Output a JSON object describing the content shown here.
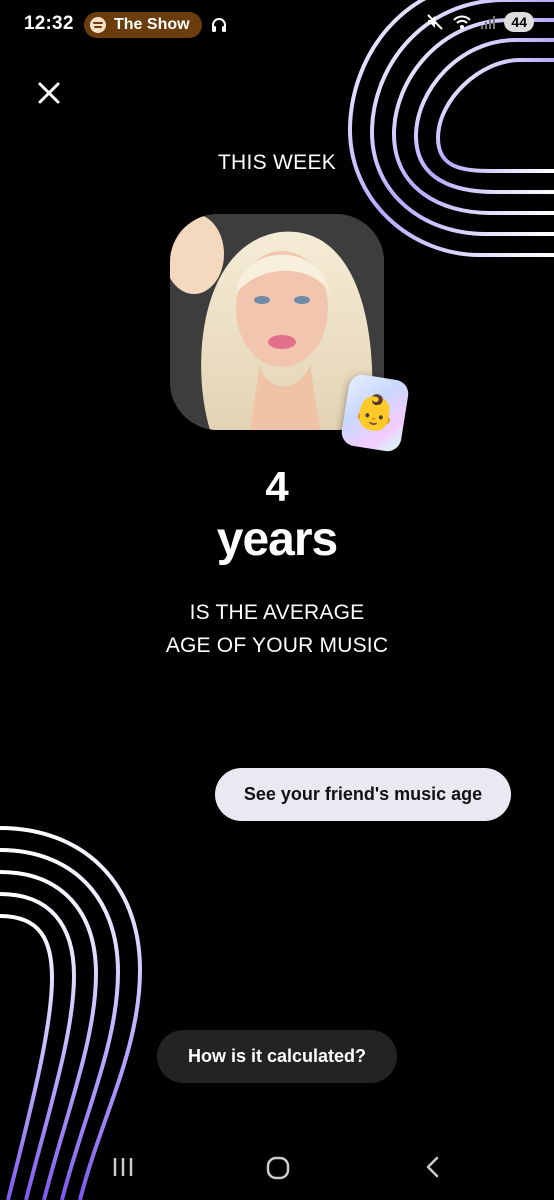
{
  "status_bar": {
    "time": "12:32",
    "now_playing": "The Show",
    "battery": "44",
    "icons": [
      "spotify-icon",
      "headphones-icon",
      "mute-icon",
      "wifi-icon",
      "signal-icon",
      "battery-icon"
    ]
  },
  "close": {
    "icon": "close-icon"
  },
  "period_label": "THIS WEEK",
  "profile": {
    "badge_emoji": "👶"
  },
  "age": {
    "number": "4",
    "unit": "years"
  },
  "caption": {
    "line1": "IS THE AVERAGE",
    "line2": "AGE OF YOUR MUSIC"
  },
  "buttons": {
    "friend": "See your friend's music age",
    "calculated": "How is it calculated?"
  },
  "nav": [
    "recents-icon",
    "home-icon",
    "back-icon"
  ],
  "colors": {
    "background": "#000000",
    "pill_brown": "#6b3d0d",
    "primary_button": "#ece8f1",
    "secondary_button": "#232323",
    "stripe_accent": "#9a7cf0"
  }
}
